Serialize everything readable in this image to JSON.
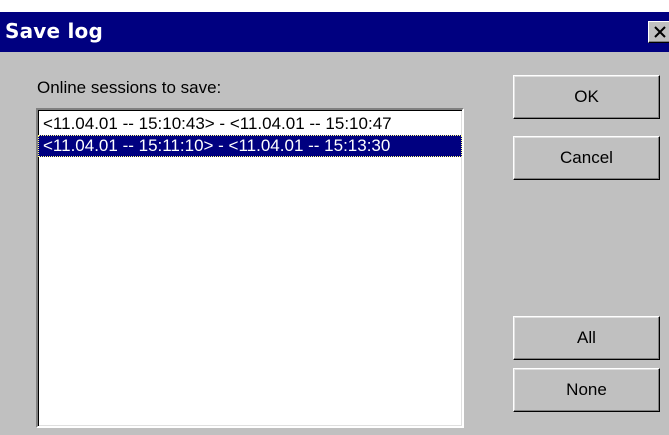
{
  "window": {
    "title": "Save log",
    "close_glyph": "✕"
  },
  "sessions": {
    "label": "Online sessions to save:",
    "items": [
      {
        "text": "<11.04.01 -- 15:10:43> - <11.04.01 -- 15:10:47",
        "selected": false
      },
      {
        "text": "<11.04.01 -- 15:11:10> - <11.04.01 -- 15:13:30",
        "selected": true
      }
    ]
  },
  "buttons": {
    "ok": "OK",
    "cancel": "Cancel",
    "all": "All",
    "none": "None"
  },
  "colors": {
    "title_bar": "#000080",
    "face": "#c0c0c0",
    "selection": "#000080",
    "selection_text": "#ffffff"
  }
}
